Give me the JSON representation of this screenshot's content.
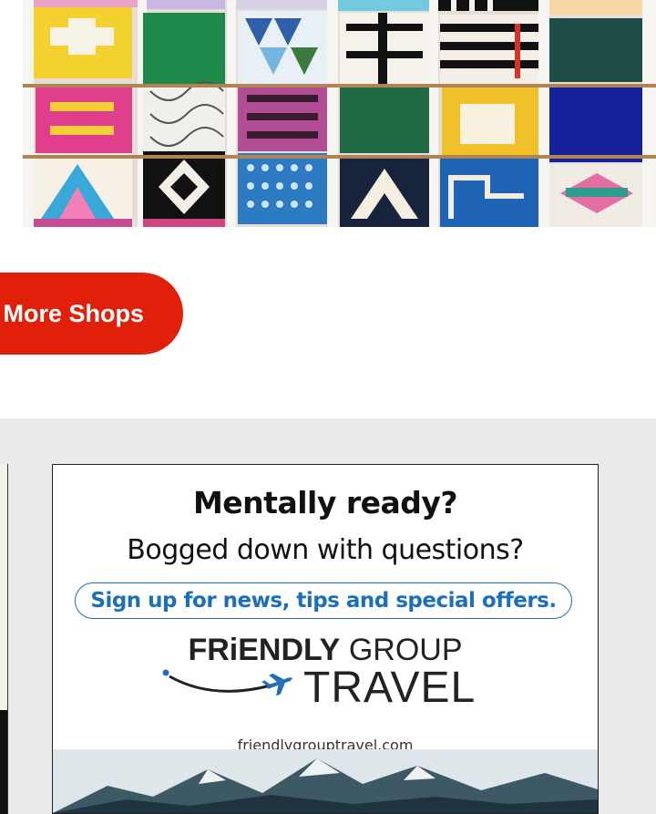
{
  "hero": {
    "image_description_icon": "pillow-grid-image"
  },
  "actions": {
    "explore_label": "Explore More Shops"
  },
  "ad": {
    "headline": "Mentally ready?",
    "subheadline": "Bogged down with questions?",
    "cta": "Sign up for news, tips and special offers.",
    "brand_bold": "FRiENDLY",
    "brand_light": " GROUP",
    "brand_travel": "TRAVEL",
    "url": "friendlygrouptravel.com",
    "accent_color": "#1d6fb8"
  },
  "colors": {
    "button_red": "#e0200b",
    "band_grey": "#eaeaea"
  }
}
